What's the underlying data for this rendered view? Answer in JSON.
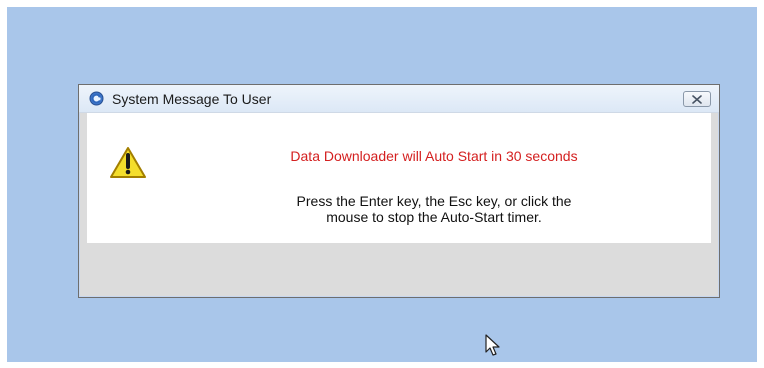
{
  "dialog": {
    "title": "System Message To User",
    "close_icon": "close-icon",
    "title_icon": "app-refresh-icon",
    "warning_icon": "warning-icon",
    "message_primary": "Data Downloader will Auto Start in 30 seconds",
    "message_secondary": {
      "line1": "Press the Enter key, the Esc key, or click the",
      "line2": "mouse to stop the Auto-Start timer."
    }
  },
  "colors": {
    "desktop_bg": "#a9c6ea",
    "dialog_bg": "#dcdcdc",
    "content_bg": "#ffffff",
    "warning_text": "#d42020",
    "text": "#111111"
  },
  "cursor": {
    "icon": "mouse-pointer-icon"
  }
}
